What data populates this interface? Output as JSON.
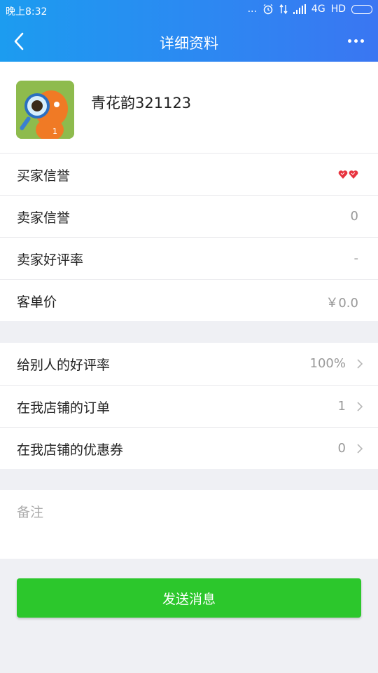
{
  "status_bar": {
    "time": "晚上8:32",
    "dots": "...",
    "network": "4G",
    "hd": "HD"
  },
  "header": {
    "title": "详细资料"
  },
  "profile": {
    "name": "青花韵321123"
  },
  "info_rows": [
    {
      "label": "买家信誉",
      "value": ""
    },
    {
      "label": "卖家信誉",
      "value": "0"
    },
    {
      "label": "卖家好评率",
      "value": "-"
    },
    {
      "label": "客单价",
      "value": "￥0.0"
    }
  ],
  "stats_rows": [
    {
      "label": "给别人的好评率",
      "value": "100%"
    },
    {
      "label": "在我店铺的订单",
      "value": "1"
    },
    {
      "label": "在我店铺的优惠券",
      "value": "0"
    }
  ],
  "note": {
    "placeholder": "备注"
  },
  "send_button": {
    "label": "发送消息"
  },
  "colors": {
    "header_gradient_start": "#1c9cf0",
    "header_gradient_end": "#3a76f2",
    "send_button": "#2cc72c",
    "heart": "#e8343f"
  }
}
